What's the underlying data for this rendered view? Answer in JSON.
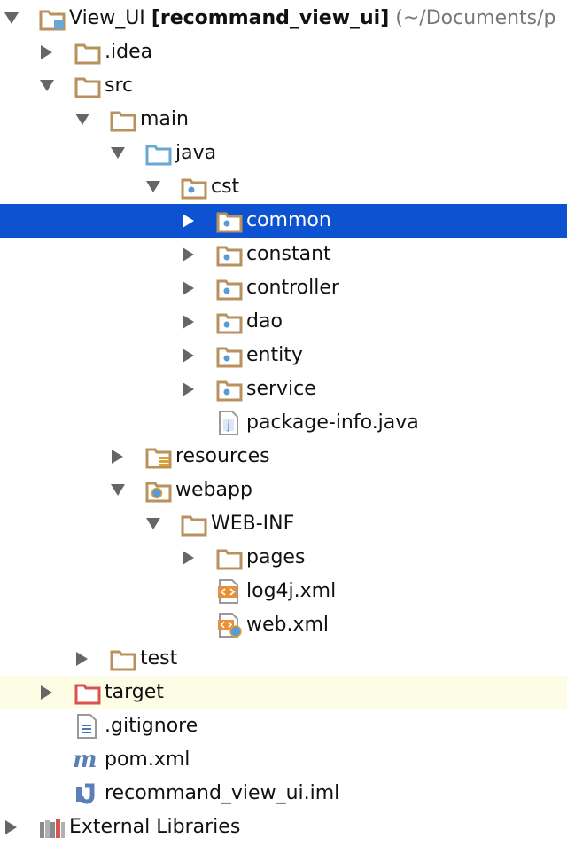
{
  "project_view": {
    "root": {
      "name": "View_UI",
      "module": "[recommand_view_ui]",
      "path": "(~/Documents/p"
    },
    "nodes": [
      {
        "label": ".idea"
      },
      {
        "label": "src"
      },
      {
        "label": "main"
      },
      {
        "label": "java"
      },
      {
        "label": "cst"
      },
      {
        "label": "common"
      },
      {
        "label": "constant"
      },
      {
        "label": "controller"
      },
      {
        "label": "dao"
      },
      {
        "label": "entity"
      },
      {
        "label": "service"
      },
      {
        "label": "package-info.java"
      },
      {
        "label": "resources"
      },
      {
        "label": "webapp"
      },
      {
        "label": "WEB-INF"
      },
      {
        "label": "pages"
      },
      {
        "label": "log4j.xml"
      },
      {
        "label": "web.xml"
      },
      {
        "label": "test"
      },
      {
        "label": "target"
      },
      {
        "label": ".gitignore"
      },
      {
        "label": "pom.xml"
      },
      {
        "label": "recommand_view_ui.iml"
      },
      {
        "label": "External Libraries"
      }
    ]
  },
  "colors": {
    "selection": "#0d52d1",
    "excluded_row": "#fdfde6",
    "folder": "#b8915d",
    "source_root": "#6aa8d4",
    "package_dot": "#5b9bd5",
    "xml": "#e8913a",
    "excluded_folder": "#d9534f"
  }
}
